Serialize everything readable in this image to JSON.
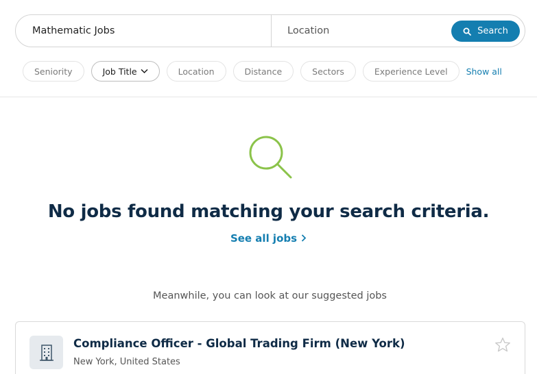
{
  "search": {
    "keyword_value": "Mathematic Jobs",
    "location_placeholder": "Location",
    "button_label": "Search"
  },
  "filters": {
    "chips": [
      "Seniority",
      "Job Title",
      "Location",
      "Distance",
      "Sectors",
      "Experience Level"
    ],
    "active_chip": "Job Title",
    "show_all_label": "Show all"
  },
  "empty_state": {
    "icon": "search-icon",
    "title": "No jobs found matching your search criteria.",
    "see_all_label": "See all jobs"
  },
  "suggestions": {
    "heading": "Meanwhile, you can look at our suggested jobs",
    "jobs": [
      {
        "title": "Compliance Officer - Global Trading Firm (New York)",
        "location": "New York, United States",
        "logo_icon": "building-icon",
        "favorite_icon": "star-icon"
      }
    ]
  },
  "colors": {
    "accent": "#147eb0",
    "heading": "#0f2b46",
    "empty_icon": "#8bc34a"
  }
}
